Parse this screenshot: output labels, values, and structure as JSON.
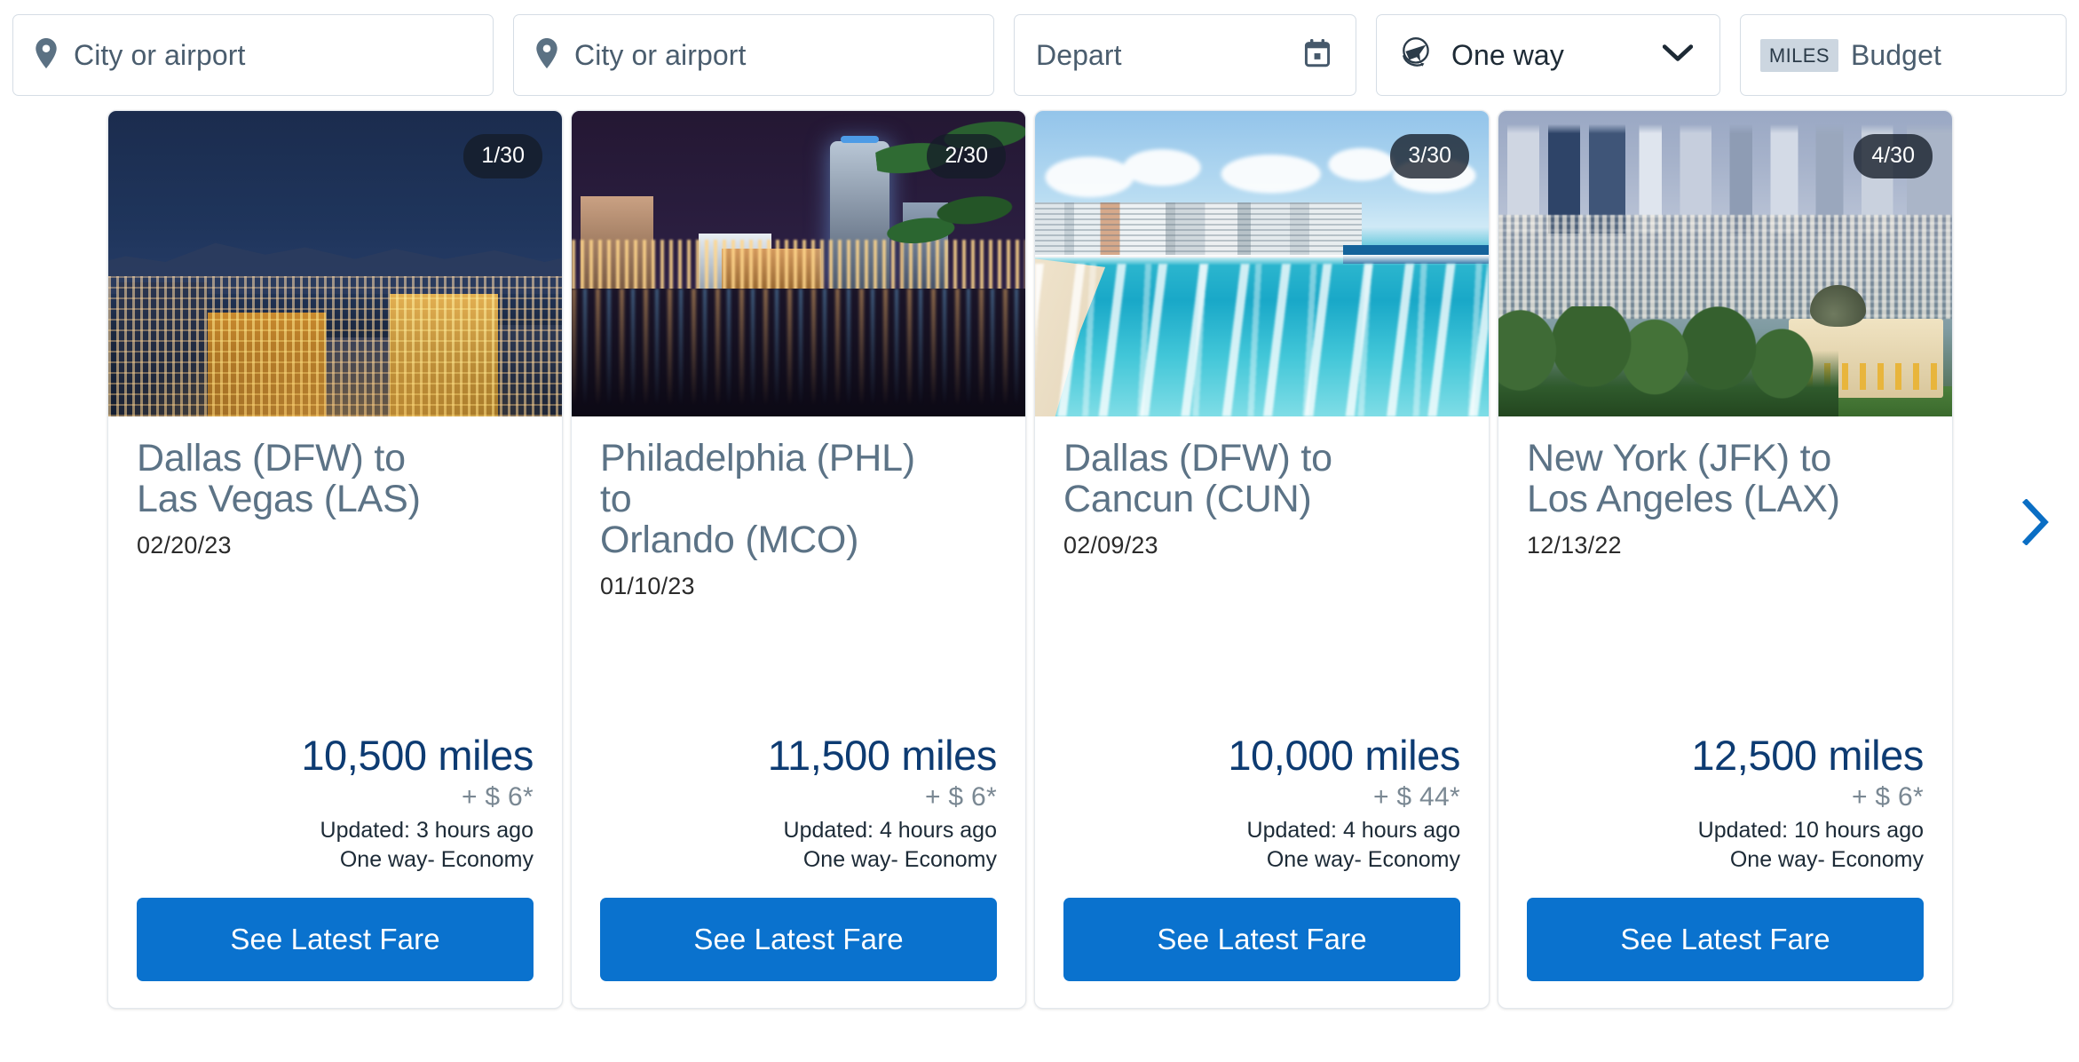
{
  "search": {
    "origin": {
      "placeholder": "City or airport",
      "value": "",
      "icon": "location-pin-icon"
    },
    "destination": {
      "placeholder": "City or airport",
      "value": "",
      "icon": "location-pin-icon"
    },
    "depart": {
      "placeholder": "Depart",
      "value": "",
      "icon": "calendar-icon"
    },
    "trip_type": {
      "label": "One way",
      "icon": "plane-icon",
      "chevron": "chevron-down-icon"
    },
    "budget": {
      "unit_chip": "MILES",
      "placeholder": "Budget",
      "value": ""
    }
  },
  "carousel": {
    "next_label": "Next",
    "next_icon": "chevron-right-icon",
    "cards": [
      {
        "badge": "1/30",
        "route": "Dallas (DFW) to\nLas Vegas (LAS)",
        "date": "02/20/23",
        "miles": "10,500 miles",
        "surcharge": "+ $ 6*",
        "updated": "Updated: 3 hours ago",
        "cabin": "One way-  Economy",
        "cta": "See Latest Fare",
        "image_alt": "las-vegas-strip-night-skyline"
      },
      {
        "badge": "2/30",
        "route": "Philadelphia (PHL)\n to\nOrlando (MCO)",
        "date": "01/10/23",
        "miles": "11,500 miles",
        "surcharge": "+ $ 6*",
        "updated": "Updated: 4 hours ago",
        "cabin": "One way-  Economy",
        "cta": "See Latest Fare",
        "image_alt": "orlando-lake-eola-night-skyline"
      },
      {
        "badge": "3/30",
        "route": "Dallas (DFW) to\nCancun (CUN)",
        "date": "02/09/23",
        "miles": "10,000 miles",
        "surcharge": "+ $ 44*",
        "updated": "Updated: 4 hours ago",
        "cabin": "One way-  Economy",
        "cta": "See Latest Fare",
        "image_alt": "cancun-beach-turquoise-water"
      },
      {
        "badge": "4/30",
        "route": "New York (JFK) to\nLos Angeles (LAX)",
        "date": "12/13/22",
        "miles": "12,500 miles",
        "surcharge": "+ $ 6*",
        "updated": "Updated: 10 hours ago",
        "cabin": "One way-  Economy",
        "cta": "See Latest Fare",
        "image_alt": "los-angeles-skyline-griffith-observatory"
      }
    ]
  },
  "colors": {
    "accent_blue": "#0a72ce",
    "miles_navy": "#0d3b72",
    "route_slate": "#5c7386",
    "field_border": "#d5dde5",
    "chip_bg": "#ccd6e0"
  }
}
